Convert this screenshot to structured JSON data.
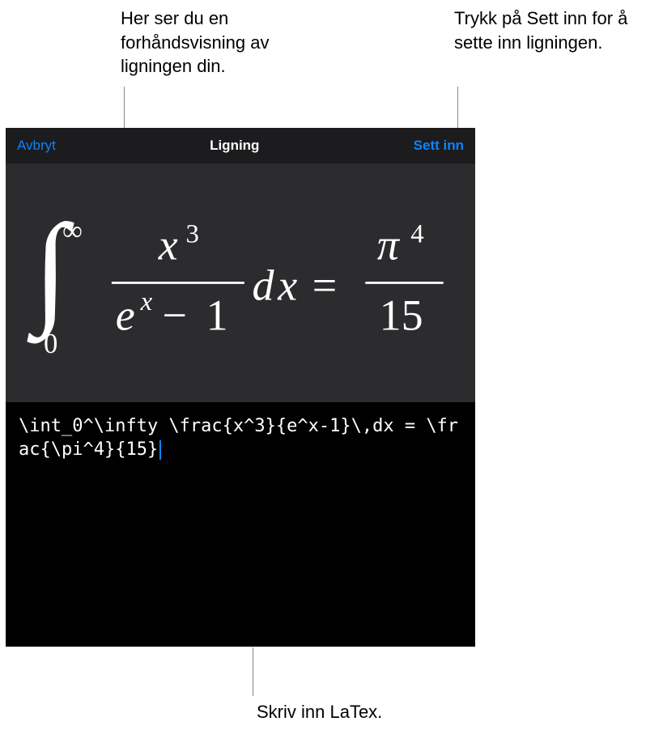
{
  "callouts": {
    "preview": "Her ser du en forhåndsvisning av ligningen din.",
    "insert": "Trykk på Sett inn for å sette inn ligningen.",
    "latex": "Skriv inn LaTex."
  },
  "header": {
    "cancel": "Avbryt",
    "title": "Ligning",
    "insert": "Sett inn"
  },
  "editor": {
    "latex_input": "\\int_0^\\infty \\frac{x^3}{e^x-1}\\,dx = \\frac{\\pi^4}{15}"
  }
}
